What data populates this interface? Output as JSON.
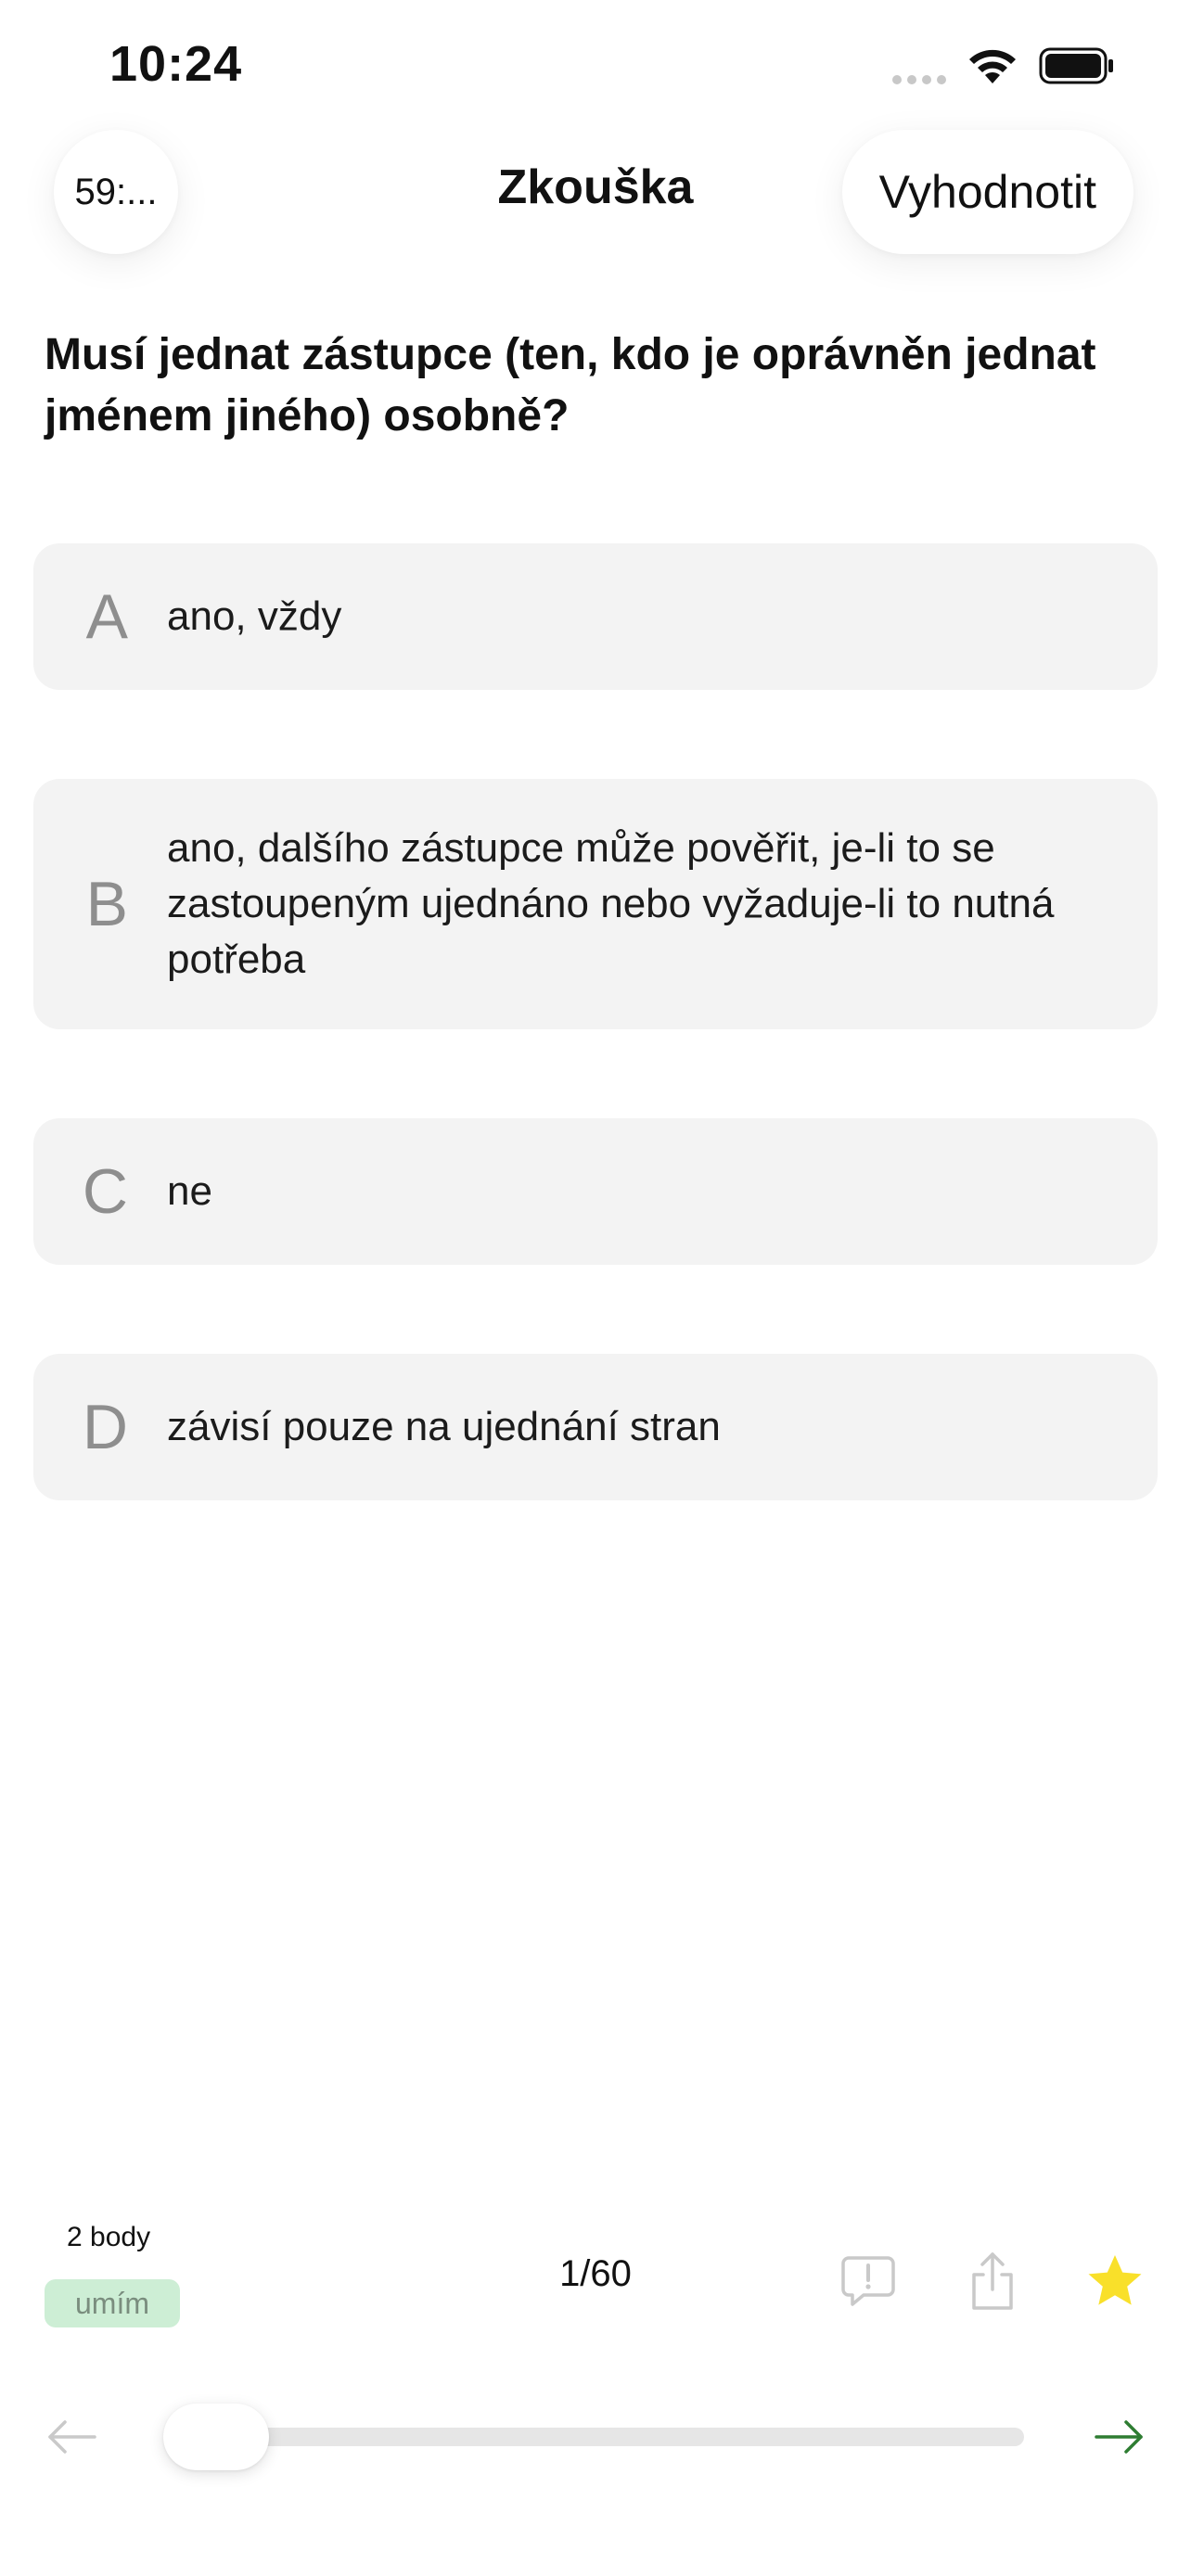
{
  "status_bar": {
    "time": "10:24"
  },
  "header": {
    "timer": "59:...",
    "title": "Zkouška",
    "evaluate_label": "Vyhodnotit"
  },
  "question": {
    "text": "Musí jednat zástupce (ten, kdo je oprávněn jednat jménem jiného) osobně?"
  },
  "answers": [
    {
      "letter": "A",
      "text": "ano, vždy"
    },
    {
      "letter": "B",
      "text": "ano, dalšího zástupce může pověřit, je-li to se zastoupeným ujednáno nebo vyžaduje-li to nutná potřeba"
    },
    {
      "letter": "C",
      "text": "ne"
    },
    {
      "letter": "D",
      "text": "závisí pouze na ujednání stran"
    }
  ],
  "footer": {
    "points": "2 body",
    "know_badge": "umím",
    "page_counter": "1/60",
    "progress": 0.0167,
    "icons": {
      "report": "report-bubble-icon",
      "share": "share-icon",
      "favorite": "star-icon",
      "prev": "arrow-left-icon",
      "next": "arrow-right-icon"
    }
  },
  "colors": {
    "answer_bg": "#f3f3f3",
    "letter": "#8e8e8e",
    "badge_bg": "#cdeed5",
    "star": "#f9e02a",
    "next_arrow": "#2e7d32",
    "disabled": "#c9c9c9"
  }
}
